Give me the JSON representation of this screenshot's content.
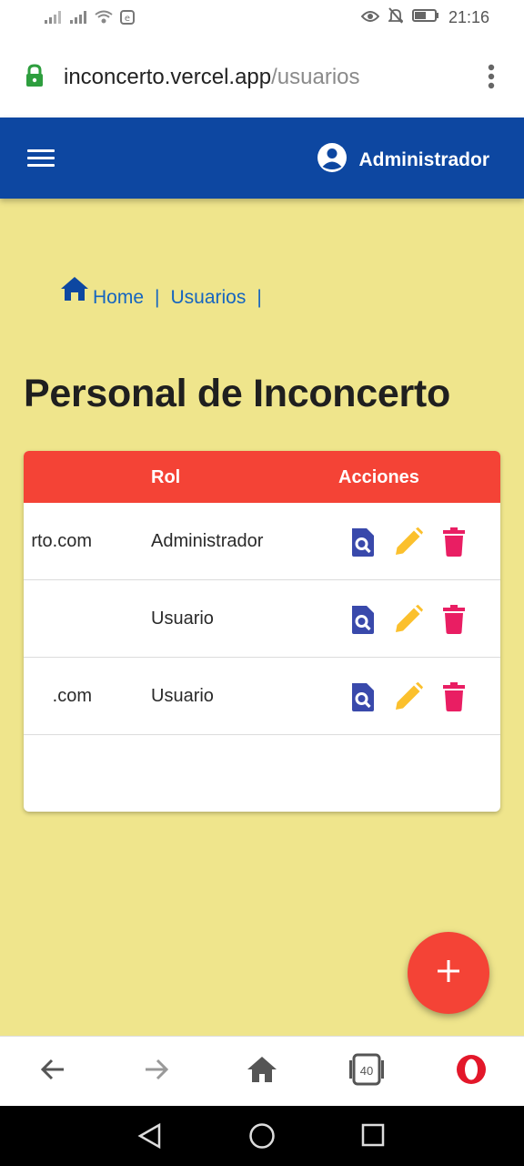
{
  "status": {
    "time": "21:16"
  },
  "browser": {
    "url_domain": "inconcerto.vercel.app",
    "url_path": "/usuarios"
  },
  "appbar": {
    "user_label": "Administrador"
  },
  "breadcrumb": {
    "home": "Home",
    "sep1": "|",
    "users": "Usuarios",
    "sep2": "|"
  },
  "page": {
    "title": "Personal de Inconcerto"
  },
  "table": {
    "headers": {
      "rol": "Rol",
      "acciones": "Acciones"
    },
    "rows": [
      {
        "email": "rto.com",
        "rol": "Administrador"
      },
      {
        "email": "",
        "rol": "Usuario"
      },
      {
        "email": ".com",
        "rol": "Usuario"
      }
    ]
  },
  "fab": {
    "label": "+"
  },
  "tab_count": "40",
  "colors": {
    "appbar": "#0d47a1",
    "background": "#efe58c",
    "table_header": "#f44336",
    "view_icon": "#3949ab",
    "edit_icon": "#fbc02d",
    "delete_icon": "#e91e63",
    "fab": "#f44336"
  },
  "icons": [
    "signal-icon",
    "wifi-icon",
    "eye-icon",
    "bell-off-icon",
    "battery-icon",
    "lock-icon",
    "more-vert-icon",
    "menu-icon",
    "account-circle-icon",
    "home-icon",
    "view-doc-icon",
    "edit-icon",
    "delete-icon",
    "add-icon",
    "back-arrow-icon",
    "forward-arrow-icon",
    "tabs-icon",
    "opera-icon"
  ]
}
